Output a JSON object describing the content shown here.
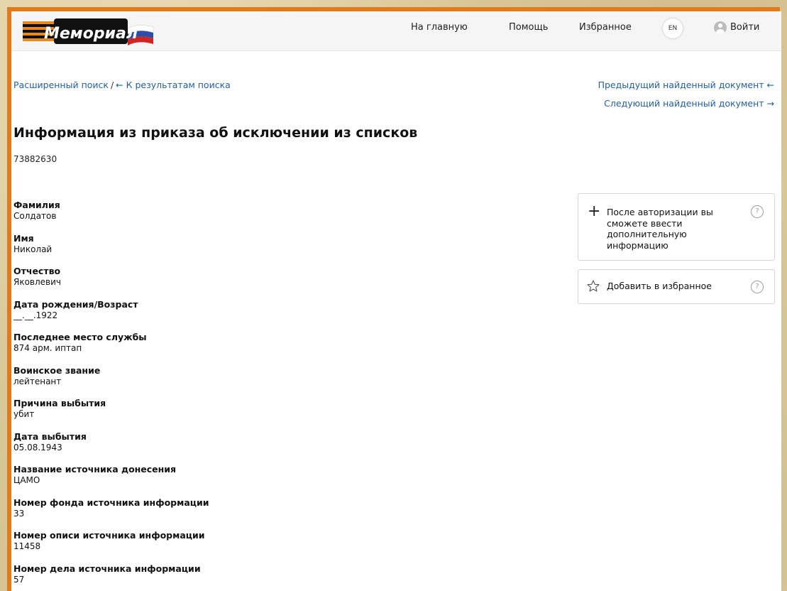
{
  "header": {
    "logo_text": "Мемориал",
    "nav": {
      "home": "На главную",
      "help": "Помощь",
      "favorites": "Избранное"
    },
    "lang": "EN",
    "login": "Войти"
  },
  "breadcrumb": {
    "advanced_search": "Расширенный поиск",
    "separator": "/",
    "back_to_results": "← К результатам поиска"
  },
  "nav_docs": {
    "previous": "Предыдущий найденный документ ←",
    "next": "Следующий найденный документ →"
  },
  "page_title": "Информация из приказа об исключении из списков",
  "doc_id": "73882630",
  "fields": [
    {
      "label": "Фамилия",
      "value": "Солдатов"
    },
    {
      "label": "Имя",
      "value": "Николай"
    },
    {
      "label": "Отчество",
      "value": "Яковлевич"
    },
    {
      "label": "Дата рождения/Возраст",
      "value": "__.__.1922"
    },
    {
      "label": "Последнее место службы",
      "value": "874 арм. иптап"
    },
    {
      "label": "Воинское звание",
      "value": "лейтенант"
    },
    {
      "label": "Причина выбытия",
      "value": "убит"
    },
    {
      "label": "Дата выбытия",
      "value": "05.08.1943"
    },
    {
      "label": "Название источника донесения",
      "value": "ЦАМО"
    },
    {
      "label": "Номер фонда источника информации",
      "value": "33"
    },
    {
      "label": "Номер описи источника информации",
      "value": "11458"
    },
    {
      "label": "Номер дела источника информации",
      "value": "57"
    }
  ],
  "sidebar": {
    "auth_note": "После авторизации вы сможете ввести дополнительную информацию",
    "add_favorite": "Добавить в избранное",
    "help_glyph": "?"
  },
  "colors": {
    "frame": "#e07a1f",
    "link": "#1f5fa8",
    "ribbon_orange": "#e8891c",
    "ribbon_black": "#111111",
    "flag_blue": "#2b4fa8",
    "flag_red": "#d32424"
  }
}
